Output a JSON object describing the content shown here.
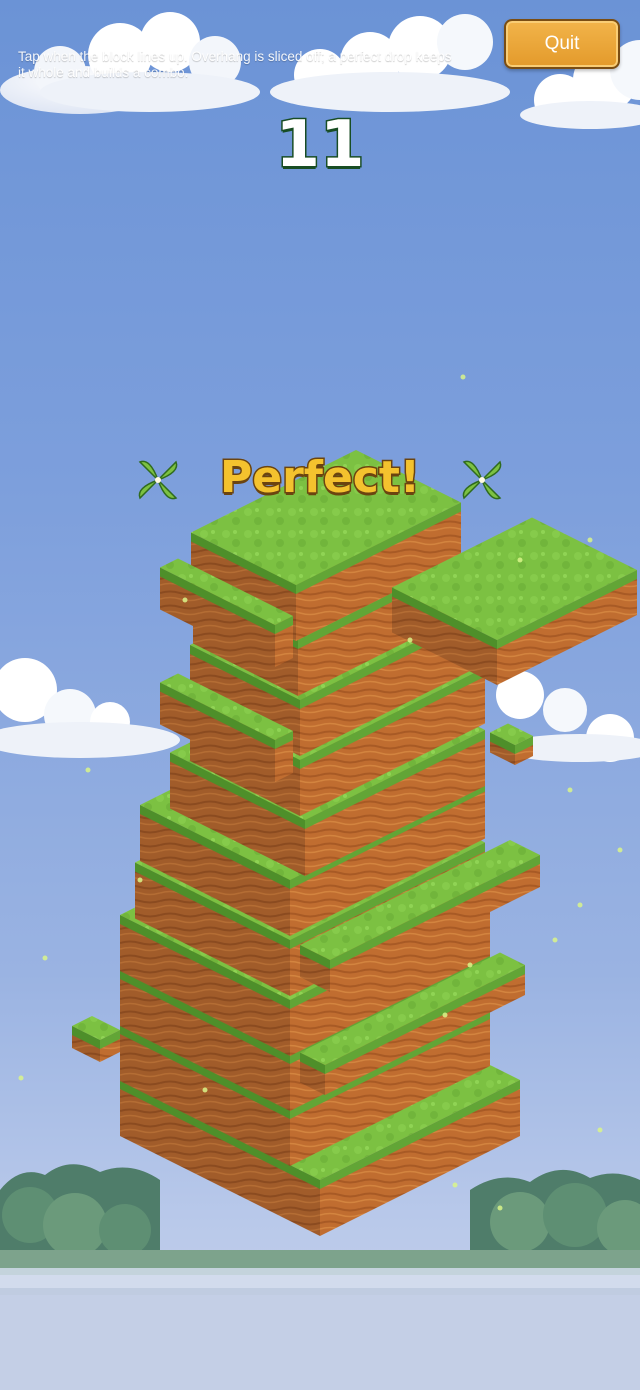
{
  "hud": {
    "hint": "Tap when the block lines up. Overhang is sliced off; a perfect drop keeps it whole and builds a combo.",
    "quit_label": "Quit",
    "score": "11"
  },
  "feedback": {
    "text": "Perfect!"
  },
  "tower": {
    "stacked_blocks": 11,
    "colors": {
      "grass_top": "#7cc142",
      "grass_dark": "#5a9a2e",
      "dirt_left": "#9a5a2a",
      "dirt_right": "#b8672c",
      "button": "#e8a534",
      "score_outline": "#184d24",
      "perfect_fill": "#f4c22e"
    }
  }
}
